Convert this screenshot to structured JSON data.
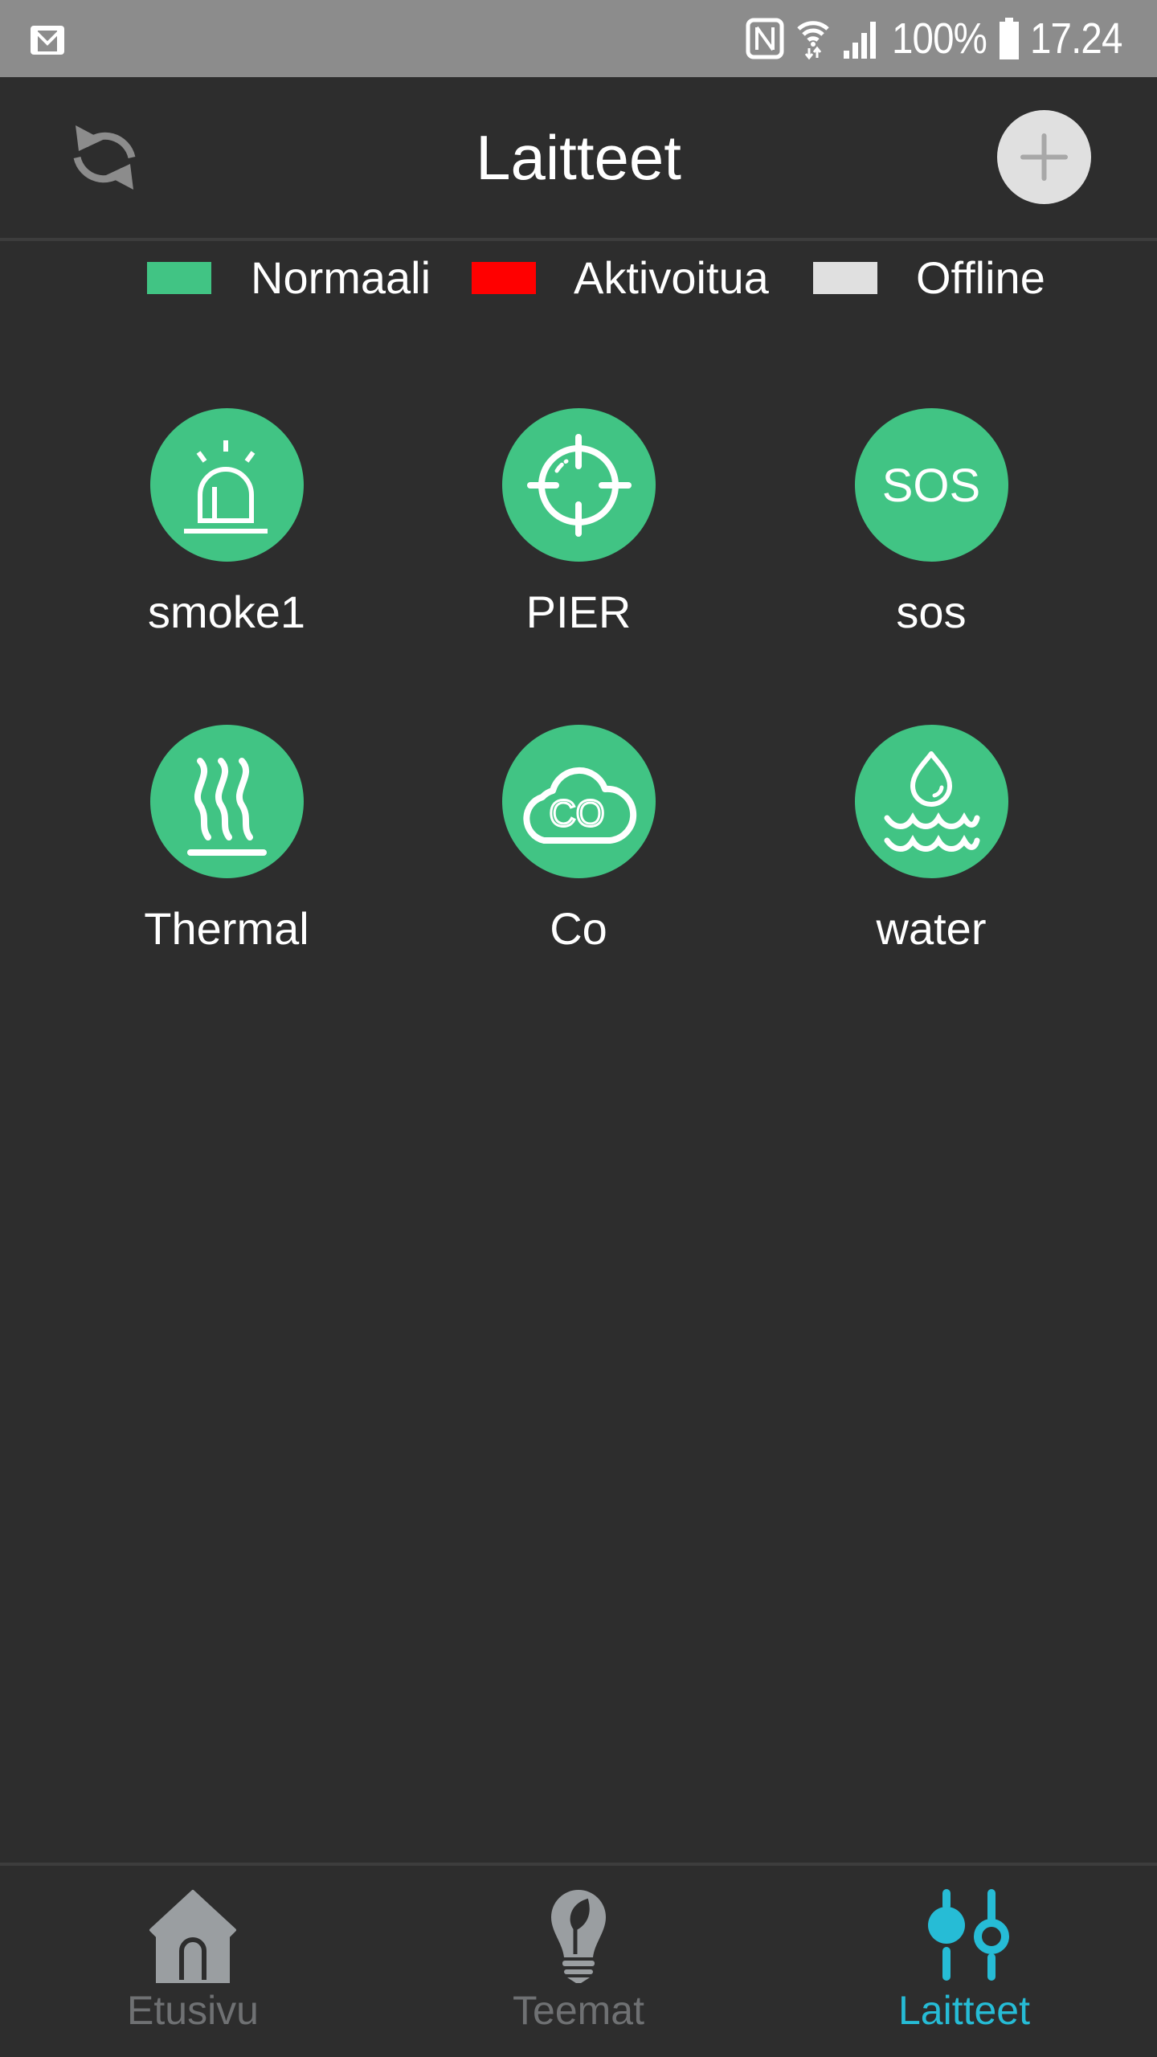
{
  "status_bar": {
    "notification_icon": "gmail-icon",
    "icons": [
      "nfc-icon",
      "wifi-icon",
      "signal-icon"
    ],
    "battery_percent": "100%",
    "battery_icon": "battery-full-icon",
    "time": "17.24"
  },
  "header": {
    "title": "Laitteet",
    "refresh_icon": "refresh-icon",
    "add_icon": "plus-icon"
  },
  "legend": [
    {
      "label": "Normaali",
      "color": "#41c484"
    },
    {
      "label": "Aktivoitua",
      "color": "#ff0000"
    },
    {
      "label": "Offline",
      "color": "#e0e0e0"
    }
  ],
  "devices": [
    {
      "name": "smoke1",
      "icon": "siren-icon",
      "status": "Normaali"
    },
    {
      "name": "PIER",
      "icon": "crosshair-icon",
      "status": "Normaali"
    },
    {
      "name": "sos",
      "icon": "sos-icon",
      "icon_text": "SOS",
      "status": "Normaali"
    },
    {
      "name": "Thermal",
      "icon": "heat-icon",
      "status": "Normaali"
    },
    {
      "name": "Co",
      "icon": "co-cloud-icon",
      "icon_text": "CO",
      "status": "Normaali"
    },
    {
      "name": "water",
      "icon": "water-leak-icon",
      "status": "Normaali"
    }
  ],
  "colors": {
    "status_normal": "#41c484",
    "status_activated": "#ff0000",
    "status_offline": "#e0e0e0",
    "nav_active": "#26bcd6",
    "nav_inactive": "#9a9ea1"
  },
  "bottom_nav": [
    {
      "label": "Etusivu",
      "icon": "home-icon",
      "active": false
    },
    {
      "label": "Teemat",
      "icon": "lightbulb-icon",
      "active": false
    },
    {
      "label": "Laitteet",
      "icon": "sliders-icon",
      "active": true
    }
  ]
}
